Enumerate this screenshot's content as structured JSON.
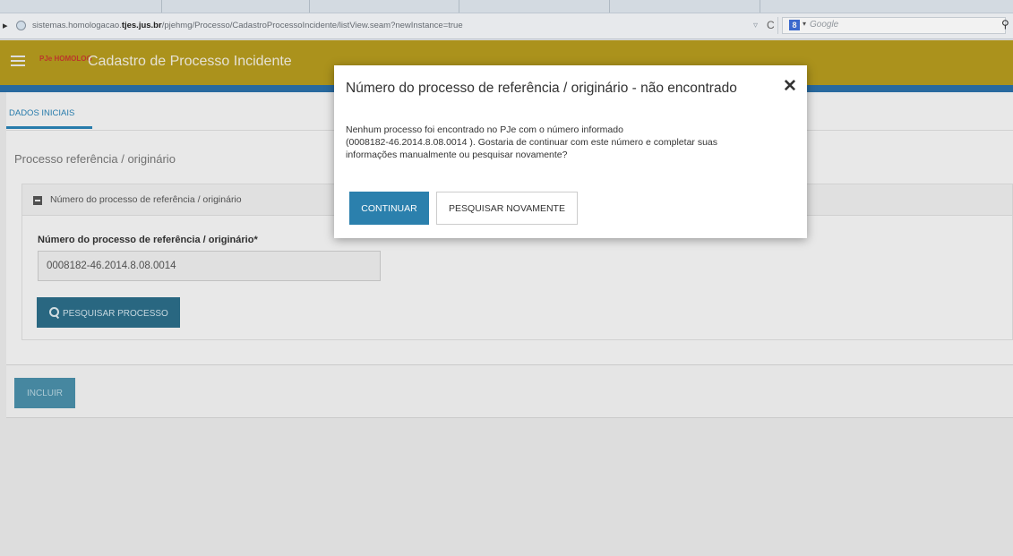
{
  "browser": {
    "url_prefix": "sistemas.homologacao.",
    "url_domain": "tjes.jus.br",
    "url_path": "/pjehmg/Processo/CadastroProcessoIncidente/listView.seam?newInstance=true",
    "search_engine_label": "8",
    "search_placeholder": "Google"
  },
  "header": {
    "logo_text": "PJe HOMOLOG",
    "title": "Cadastro de Processo Incidente",
    "bar_color": "#b59a1e"
  },
  "tabs": {
    "active_label": "DADOS INICIAIS"
  },
  "main": {
    "section_title": "Processo referência / originário",
    "panel_title": "Número do processo de referência / originário",
    "field_label": "Número do processo de referência / originário*",
    "field_value": "0008182-46.2014.8.08.0014",
    "search_button_label": "PESQUISAR PROCESSO",
    "include_button_label": "INCLUIR"
  },
  "modal": {
    "title": "Número do processo de referência / originário - não encontrado",
    "close_label": "✕",
    "body_line1": "Nenhum processo foi encontrado no PJe com o número informado",
    "body_line2": "(0008182-46.2014.8.08.0014 ). Gostaria de continuar com este número e completar suas",
    "body_line3": "informações manualmente ou pesquisar novamente?",
    "continue_label": "CONTINUAR",
    "search_again_label": "PESQUISAR NOVAMENTE"
  },
  "icons": [
    "back-arrow-icon",
    "globe-icon",
    "reload-icon",
    "search-icon",
    "hamburger-menu-icon",
    "minus-square-icon",
    "magnifier-icon",
    "close-icon"
  ]
}
